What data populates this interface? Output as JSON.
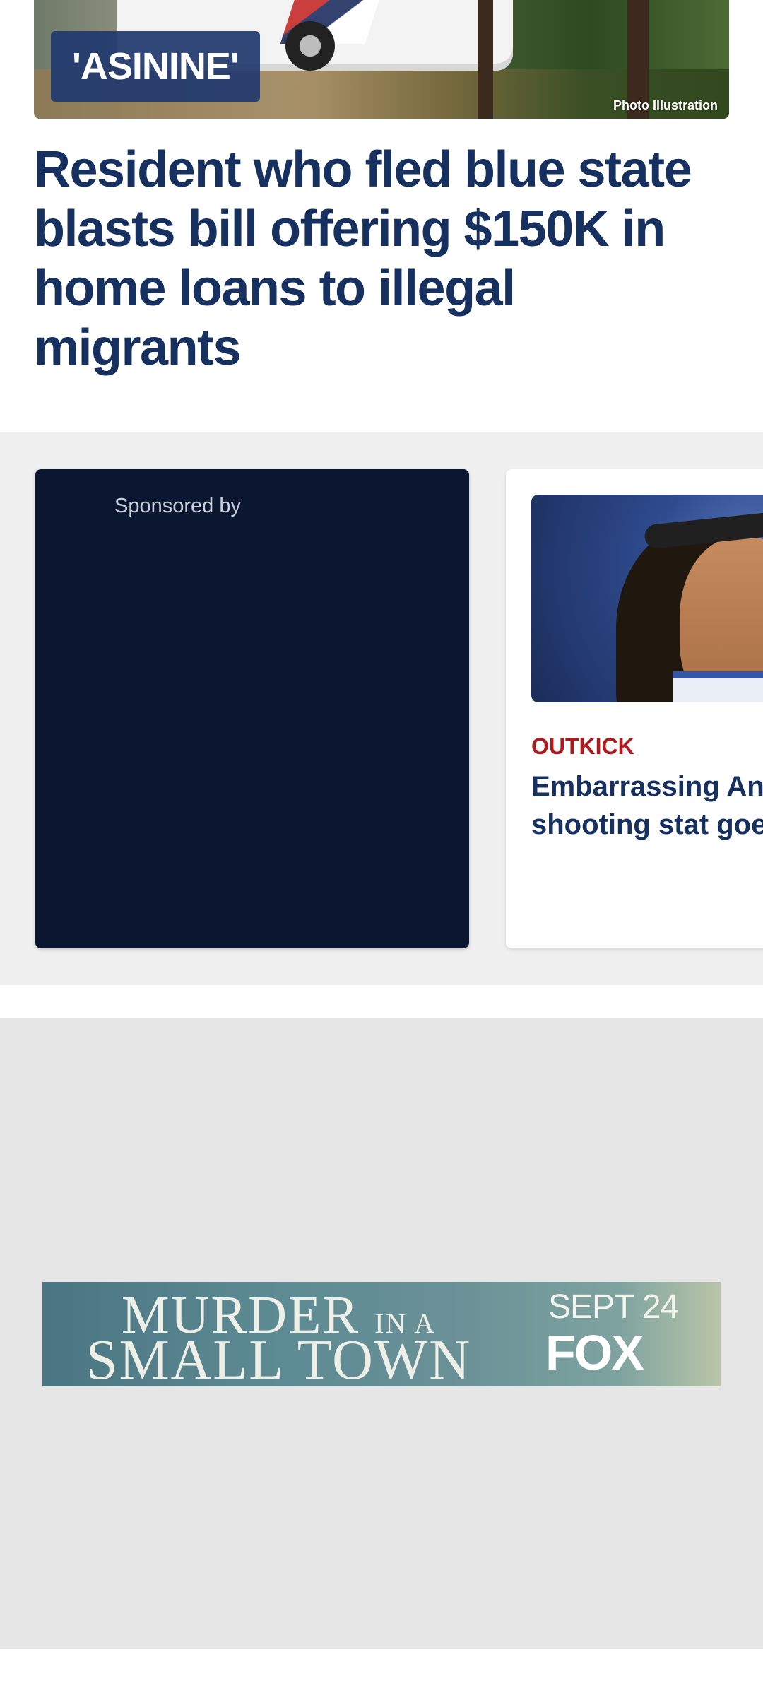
{
  "hero": {
    "tag": "'ASININE'",
    "credit": "Photo Illustration"
  },
  "headline": "Resident who fled blue state blasts bill offering $150K in home loans to illegal migrants",
  "carousel": {
    "sponsored_label": "Sponsored by",
    "story": {
      "kicker": "OUTKICK",
      "title": "Embarrassing Ange\nshooting stat goes"
    }
  },
  "ad": {
    "title_line1": "MURDER",
    "title_in_a": "IN A",
    "title_line2": "SMALL TOWN",
    "date": "SEPT 24",
    "network": "FOX"
  }
}
